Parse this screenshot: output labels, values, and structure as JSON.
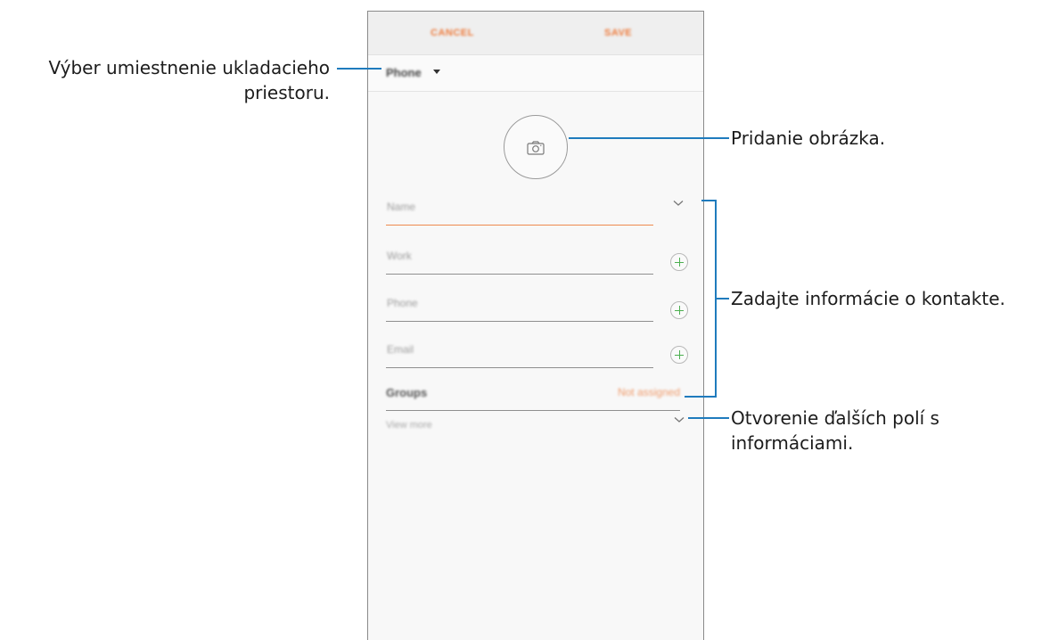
{
  "phone": {
    "topbar": {
      "cancel_label": "CANCEL",
      "save_label": "SAVE"
    },
    "storage": {
      "label": "Phone"
    },
    "fields": {
      "name_placeholder": "Name",
      "work_placeholder": "Work",
      "phone_placeholder": "Phone",
      "email_placeholder": "Email"
    },
    "groups": {
      "label": "Groups",
      "value": "Not assigned"
    },
    "more_fields_label": "View more"
  },
  "annotations": {
    "storage_line1": "Výber umiestnenie ukladacieho",
    "storage_line2": "priestoru.",
    "photo": "Pridanie obrázka.",
    "contact_info": "Zadajte informácie o kontakte.",
    "more_line1": "Otvorenie ďalších polí s",
    "more_line2": "informáciami."
  },
  "colors": {
    "accent": "#ee7b3c",
    "annotation_line": "#1f7bbd",
    "plus_icon": "#4caf50"
  }
}
